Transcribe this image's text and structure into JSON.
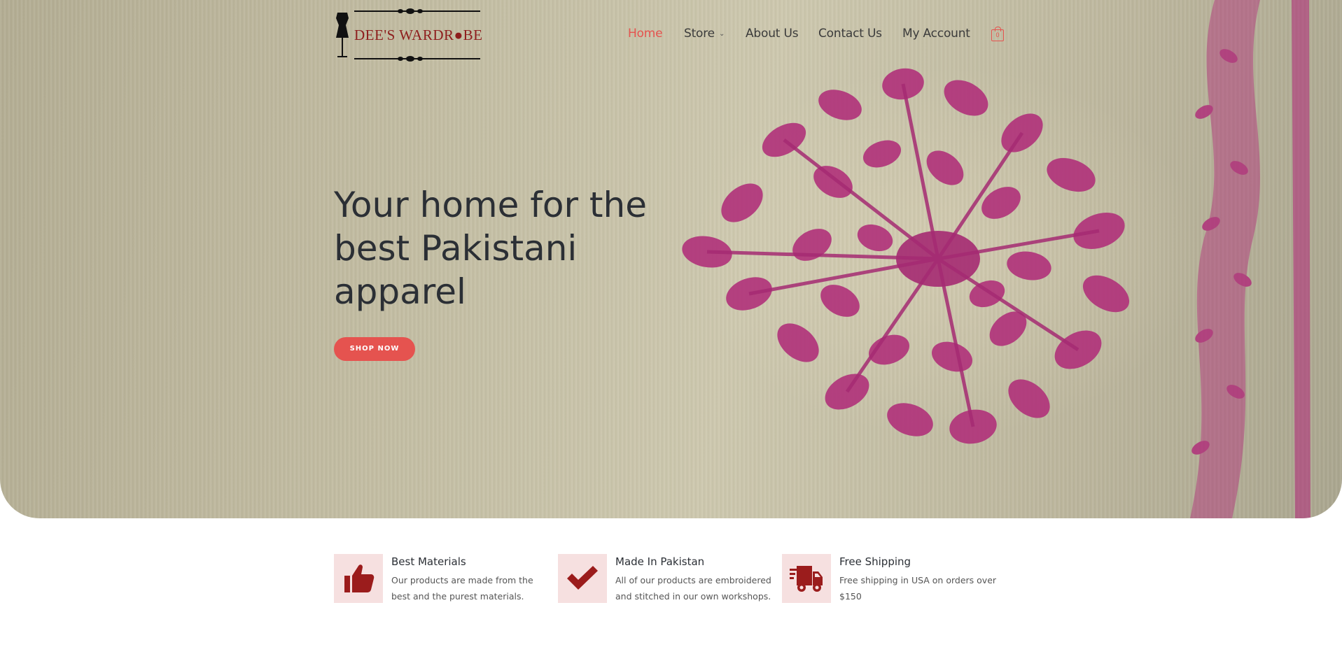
{
  "header": {
    "logo_text": "DEE'S WARDR●BE",
    "nav": [
      {
        "label": "Home",
        "active": true
      },
      {
        "label": "Store",
        "has_dropdown": true
      },
      {
        "label": "About Us"
      },
      {
        "label": "Contact Us"
      },
      {
        "label": "My Account"
      }
    ],
    "cart_count": "0"
  },
  "hero": {
    "title": "Your home for the best Pakistani apparel",
    "button_label": "SHOP NOW"
  },
  "features": [
    {
      "icon": "thumbs-up-icon",
      "title": "Best Materials",
      "description": "Our products are made from the best and the purest materials."
    },
    {
      "icon": "checkmark-icon",
      "title": "Made In Pakistan",
      "description": "All of our products are embroidered and stitched in our own workshops."
    },
    {
      "icon": "delivery-truck-icon",
      "title": "Free Shipping",
      "description": "Free shipping in USA on orders over $150"
    }
  ],
  "colors": {
    "accent": "#e5534f",
    "icon_red": "#9b1c1c",
    "icon_bg": "#f6e0e0",
    "heading": "#2b2f35",
    "embroidery": "#b0307a"
  }
}
